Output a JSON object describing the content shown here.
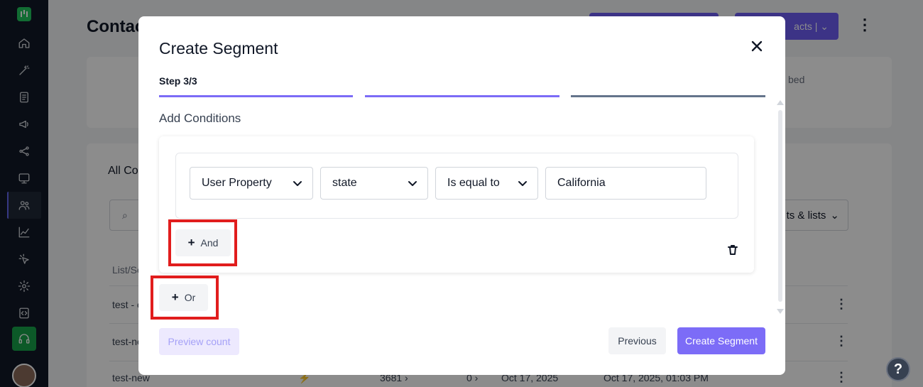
{
  "colors": {
    "sidebar_bg": "#111827",
    "accent": "#6d5ef5",
    "highlight": "#e11d1d",
    "primary_button": "#7c6cf7"
  },
  "sidebar": {
    "icons": [
      "logo-icon",
      "home-icon",
      "magic-wand-icon",
      "document-icon",
      "megaphone-icon",
      "share-icon",
      "monitor-icon",
      "contacts-icon",
      "chart-icon",
      "click-icon",
      "settings-icon",
      "code-icon",
      "headset-icon"
    ]
  },
  "background": {
    "page_title": "Contac",
    "import_btn": "acts  |  ⌄",
    "unsubscribed": "bed",
    "all_contacts": "All Co",
    "filter_label": "ts & lists",
    "table_header": "List/Se",
    "rows": [
      "test - c",
      "test-ne",
      "test-new"
    ],
    "last_row": {
      "count": "3681 ›",
      "zero": "0 ›",
      "created": "Oct 17, 2025",
      "updated": "Oct 17, 2025, 01:03 PM"
    }
  },
  "modal": {
    "title": "Create Segment",
    "step": "Step 3/3",
    "section_title": "Add Conditions",
    "condition": {
      "property_type": "User Property",
      "property": "state",
      "operator": "Is equal to",
      "value": "California"
    },
    "and_label": "And",
    "or_label": "Or",
    "preview_label": "Preview count",
    "previous_label": "Previous",
    "create_label": "Create Segment"
  },
  "help_label": "?"
}
